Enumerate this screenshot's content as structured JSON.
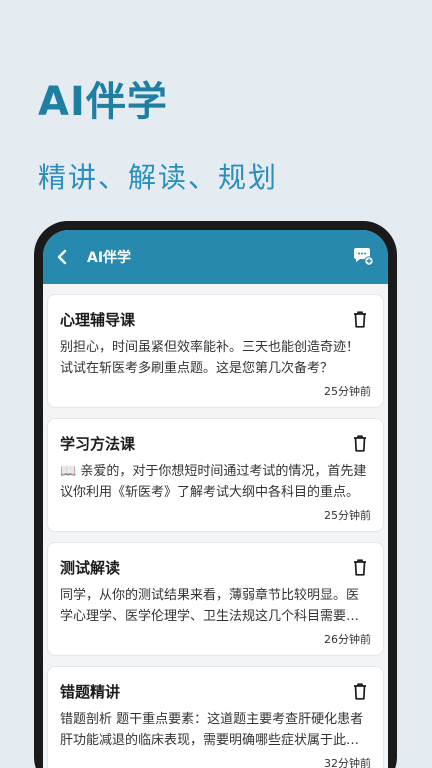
{
  "hero": {
    "title": "AI伴学",
    "subtitle": "精讲、解读、规划"
  },
  "app_bar": {
    "title": "AI伴学",
    "back_icon": "chevron-left-icon",
    "action_icon": "chat-add-icon"
  },
  "colors": {
    "background": "#e4ebf1",
    "brand": "#2689ad",
    "hero_title": "#1e7fa3"
  },
  "sessions": [
    {
      "title": "心理辅导课",
      "preview": "别担心，时间虽紧但效率能补。三天也能创造奇迹！试试在斩医考多刷重点题。这是您第几次备考？",
      "time": "25分钟前"
    },
    {
      "title": "学习方法课",
      "preview": "📖 亲爱的，对于你想短时间通过考试的情况，首先建议你利用《斩医考》了解考试大纲中各科目的重点。",
      "time": "25分钟前"
    },
    {
      "title": "测试解读",
      "preview": "同学，从你的测试结果来看，薄弱章节比较明显。医学心理学、医学伦理学、卫生法规这几个科目需要加强。",
      "time": "26分钟前"
    },
    {
      "title": "错题精讲",
      "preview": "错题剖析 题干重点要素：这道题主要考查肝硬化患者肝功能减退的临床表现，需要明确哪些症状属于此类。",
      "time": "32分钟前"
    }
  ]
}
